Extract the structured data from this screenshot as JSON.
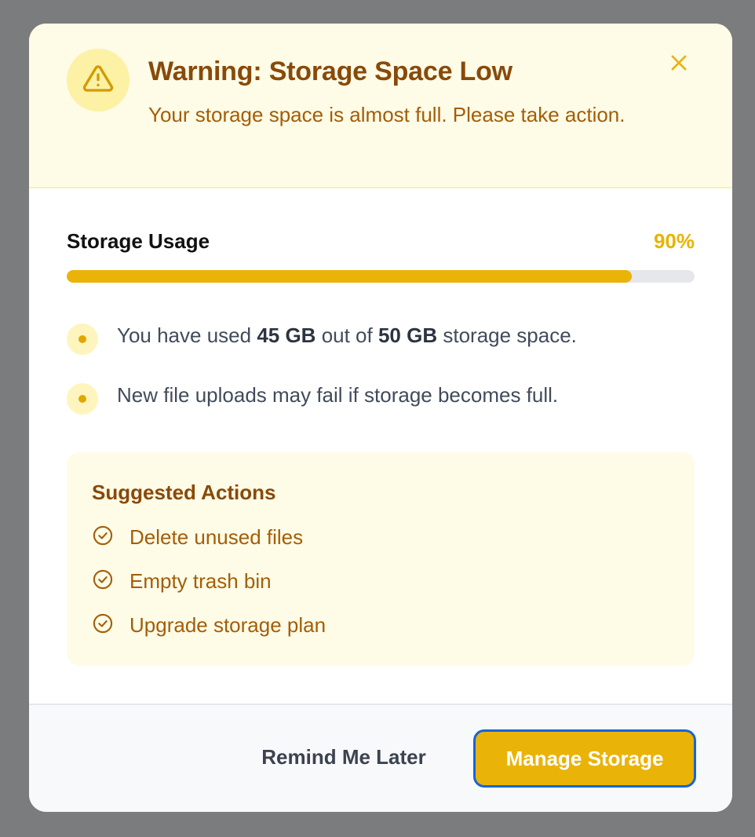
{
  "dialog": {
    "title": "Warning: Storage Space Low",
    "message": "Your storage space is almost full. Please take action.",
    "icons": {
      "warning": "warning-triangle-icon",
      "close": "close-icon"
    }
  },
  "usage": {
    "label": "Storage Usage",
    "percent_label": "90%",
    "percent": 0.9
  },
  "notes": [
    {
      "prefix": "You have used ",
      "used": "45 GB",
      "middle": " out of ",
      "total": "50 GB",
      "suffix": " storage space."
    },
    {
      "text": "New file uploads may fail if storage becomes full."
    }
  ],
  "suggested": {
    "title": "Suggested Actions",
    "items": [
      "Delete unused files",
      "Empty trash bin",
      "Upgrade storage plan"
    ],
    "icon": "check-circle-icon"
  },
  "footer": {
    "later_label": "Remind Me Later",
    "manage_label": "Manage Storage"
  },
  "colors": {
    "accent": "#eab308",
    "header_bg": "#fefbe7",
    "title": "#884a0a",
    "text_warning": "#a35e07",
    "focus_ring": "#1565d8"
  }
}
